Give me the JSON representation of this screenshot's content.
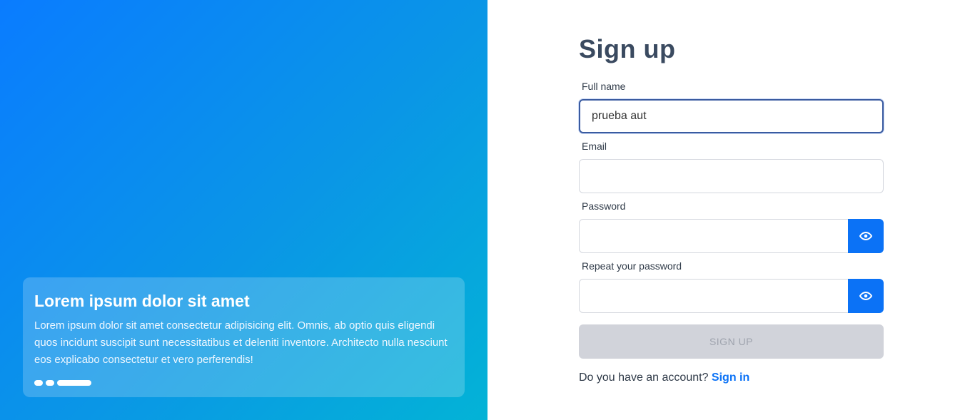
{
  "hero": {
    "title": "Lorem ipsum dolor sit amet",
    "text": "Lorem ipsum dolor sit amet consectetur adipisicing elit. Omnis, ab optio quis eligendi quos incidunt suscipit sunt necessitatibus et deleniti inventore. Architecto nulla nesciunt eos explicabo consectetur et vero perferendis!",
    "carousel_active_index": 2
  },
  "form": {
    "title": "Sign up",
    "full_name": {
      "label": "Full name",
      "value": "prueba aut"
    },
    "email": {
      "label": "Email",
      "value": ""
    },
    "password": {
      "label": "Password",
      "value": "",
      "toggle_icon": "eye-icon"
    },
    "repeat_password": {
      "label": "Repeat your password",
      "value": "",
      "toggle_icon": "eye-icon"
    },
    "submit_label": "SIGN UP",
    "footer_text": "Do you have an account?",
    "signin_label": "Sign in"
  },
  "colors": {
    "accent": "#0b72f6",
    "title": "#3a4a60",
    "disabled_button": "#d1d3da"
  }
}
